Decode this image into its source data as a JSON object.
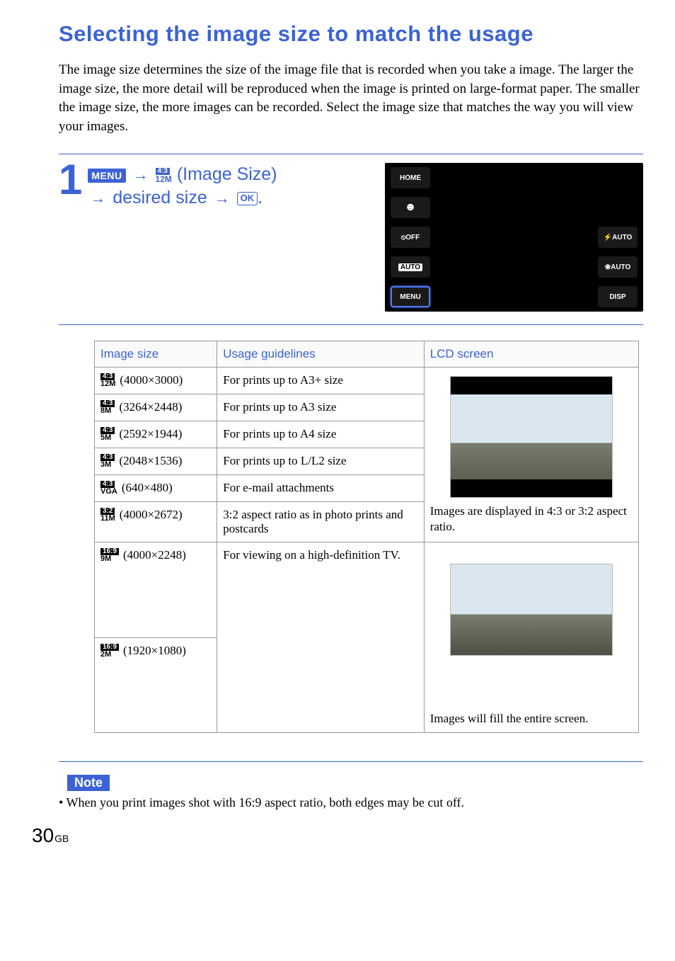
{
  "title": "Selecting the image size to match the usage",
  "intro": "The image size determines the size of the image file that is recorded when you take a image.\nThe larger the image size, the more detail will be reproduced when the image is printed on large-format paper. The smaller the image size, the more images can be recorded. Select the image size that matches the way you will view your images.",
  "step": {
    "number": "1",
    "menu_label": "MENU",
    "size_ratio": "4:3",
    "size_mp": "12M",
    "size_text": "(Image Size)",
    "desired": "desired size",
    "ok": "OK",
    "dot": "."
  },
  "camera_lcd": {
    "home": "HOME",
    "face": "☻",
    "rec": "⦸OFF",
    "rec_auto": "AUTO",
    "menu": "MENU",
    "flash": "⚡AUTO",
    "macro": "❀AUTO",
    "disp": "DISP"
  },
  "table": {
    "headers": {
      "size": "Image size",
      "usage": "Usage guidelines",
      "lcd": "LCD screen"
    },
    "group1_caption": "Images are displayed in 4:3 or 3:2 aspect ratio.",
    "group2_caption": "Images will fill the entire screen.",
    "rows": [
      {
        "ratio": "4:3",
        "mp": "12M",
        "dim": "(4000×3000)",
        "usage": "For prints up to A3+ size"
      },
      {
        "ratio": "4:3",
        "mp": "8M",
        "dim": "(3264×2448)",
        "usage": "For prints up to A3 size"
      },
      {
        "ratio": "4:3",
        "mp": "5M",
        "dim": "(2592×1944)",
        "usage": "For prints up to A4 size"
      },
      {
        "ratio": "4:3",
        "mp": "3M",
        "dim": "(2048×1536)",
        "usage": "For prints up to L/L2 size"
      },
      {
        "ratio": "4:3",
        "mp": "VGA",
        "dim": "(640×480)",
        "usage": "For e-mail attachments"
      },
      {
        "ratio": "3:2",
        "mp": "11M",
        "dim": "(4000×2672)",
        "usage": "3:2 aspect ratio as in photo prints and postcards"
      },
      {
        "ratio": "16:9",
        "mp": "9M",
        "dim": "(4000×2248)",
        "usage": "For viewing on a high-definition TV."
      },
      {
        "ratio": "16:9",
        "mp": "2M",
        "dim": "(1920×1080)",
        "usage": ""
      }
    ]
  },
  "note_label": "Note",
  "note_text": "When you print images shot with 16:9 aspect ratio, both edges may be cut off.",
  "page": {
    "num": "30",
    "lang": "GB"
  }
}
